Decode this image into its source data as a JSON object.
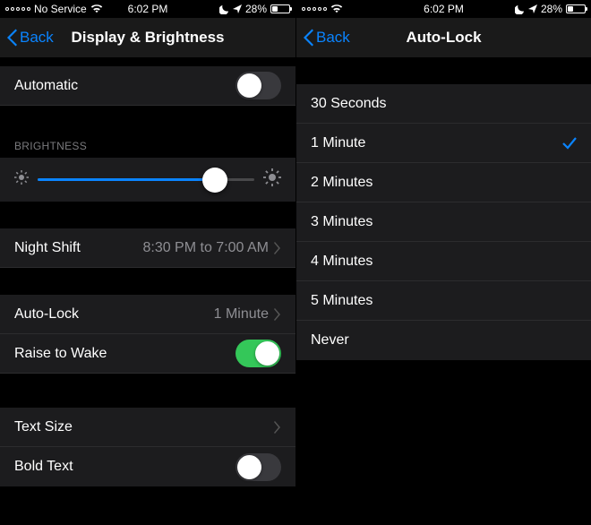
{
  "status": {
    "carrier": "No Service",
    "time": "6:02 PM",
    "battery_pct": "28%"
  },
  "left": {
    "back": "Back",
    "title": "Display & Brightness",
    "automatic": {
      "label": "Automatic",
      "on": false
    },
    "brightness_header": "BRIGHTNESS",
    "brightness_pct": 82,
    "night_shift": {
      "label": "Night Shift",
      "detail": "8:30 PM to 7:00 AM"
    },
    "auto_lock": {
      "label": "Auto-Lock",
      "detail": "1 Minute"
    },
    "raise_to_wake": {
      "label": "Raise to Wake",
      "on": true
    },
    "text_size": {
      "label": "Text Size"
    },
    "bold_text": {
      "label": "Bold Text",
      "on": false
    }
  },
  "right": {
    "back": "Back",
    "title": "Auto-Lock",
    "options": [
      {
        "label": "30 Seconds",
        "selected": false
      },
      {
        "label": "1 Minute",
        "selected": true
      },
      {
        "label": "2 Minutes",
        "selected": false
      },
      {
        "label": "3 Minutes",
        "selected": false
      },
      {
        "label": "4 Minutes",
        "selected": false
      },
      {
        "label": "5 Minutes",
        "selected": false
      },
      {
        "label": "Never",
        "selected": false
      }
    ]
  }
}
